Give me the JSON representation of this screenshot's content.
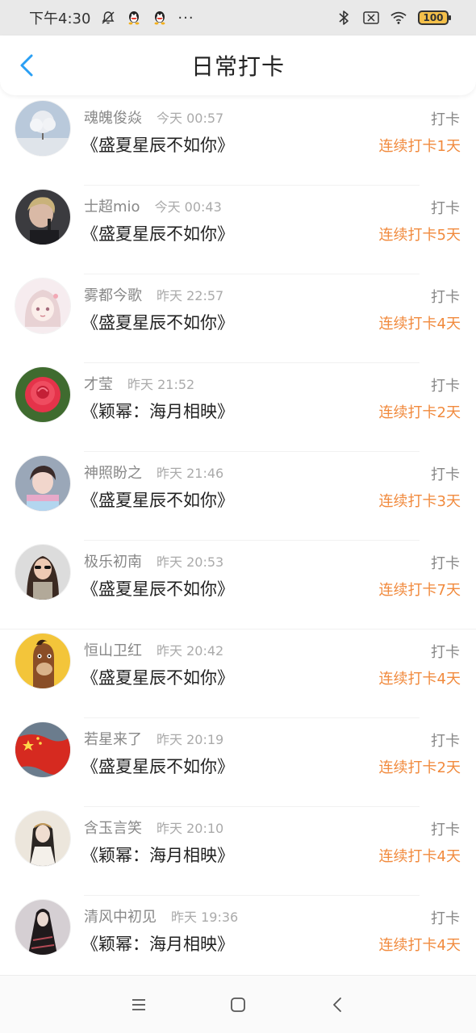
{
  "status_bar": {
    "time": "下午4:30",
    "dots": "···",
    "battery": "100",
    "icons": [
      "bell-off-icon",
      "qq-icon",
      "qq-icon",
      "bluetooth-icon",
      "sim-x-icon",
      "wifi-icon",
      "battery-icon"
    ]
  },
  "header": {
    "title": "日常打卡",
    "back_icon": "chevron-left-icon",
    "accent": "#2a9ff4"
  },
  "colors": {
    "streak": "#f18a3d",
    "secondary_text": "#888888"
  },
  "checkins": [
    {
      "user": "魂魄俊焱",
      "time": "今天 00:57",
      "book": "《盛夏星辰不如你》",
      "action": "打卡",
      "streak": "连续打卡1天",
      "avatar": "winter-tree-avatar"
    },
    {
      "user": "士超mio",
      "time": "今天 00:43",
      "book": "《盛夏星辰不如你》",
      "action": "打卡",
      "streak": "连续打卡5天",
      "avatar": "singer-avatar"
    },
    {
      "user": "雾都今歌",
      "time": "昨天 22:57",
      "book": "《盛夏星辰不如你》",
      "action": "打卡",
      "streak": "连续打卡4天",
      "avatar": "anime-girl-avatar"
    },
    {
      "user": "才莹",
      "time": "昨天 21:52",
      "book": "《颖幂：海月相映》",
      "action": "打卡",
      "streak": "连续打卡2天",
      "avatar": "rose-avatar"
    },
    {
      "user": "神照盼之",
      "time": "昨天 21:46",
      "book": "《盛夏星辰不如你》",
      "action": "打卡",
      "streak": "连续打卡3天",
      "avatar": "girl-photo-avatar"
    },
    {
      "user": "极乐初南",
      "time": "昨天 20:53",
      "book": "《盛夏星辰不如你》",
      "action": "打卡",
      "streak": "连续打卡7天",
      "avatar": "woman-sunglasses-avatar"
    },
    {
      "user": "恒山卫红",
      "time": "昨天 20:42",
      "book": "《盛夏星辰不如你》",
      "action": "打卡",
      "streak": "连续打卡4天",
      "avatar": "horse-cartoon-avatar"
    },
    {
      "user": "若星来了",
      "time": "昨天 20:19",
      "book": "《盛夏星辰不如你》",
      "action": "打卡",
      "streak": "连续打卡2天",
      "avatar": "flag-avatar"
    },
    {
      "user": "含玉言笑",
      "time": "昨天 20:10",
      "book": "《颖幂：海月相映》",
      "action": "打卡",
      "streak": "连续打卡4天",
      "avatar": "ancient-costume-avatar"
    },
    {
      "user": "清风中初见",
      "time": "昨天 19:36",
      "book": "《颖幂：海月相映》",
      "action": "打卡",
      "streak": "连续打卡4天",
      "avatar": "dark-robe-avatar"
    }
  ],
  "nav_bar": {
    "icons": [
      "menu-icon",
      "home-square-icon",
      "back-chevron-icon"
    ]
  }
}
